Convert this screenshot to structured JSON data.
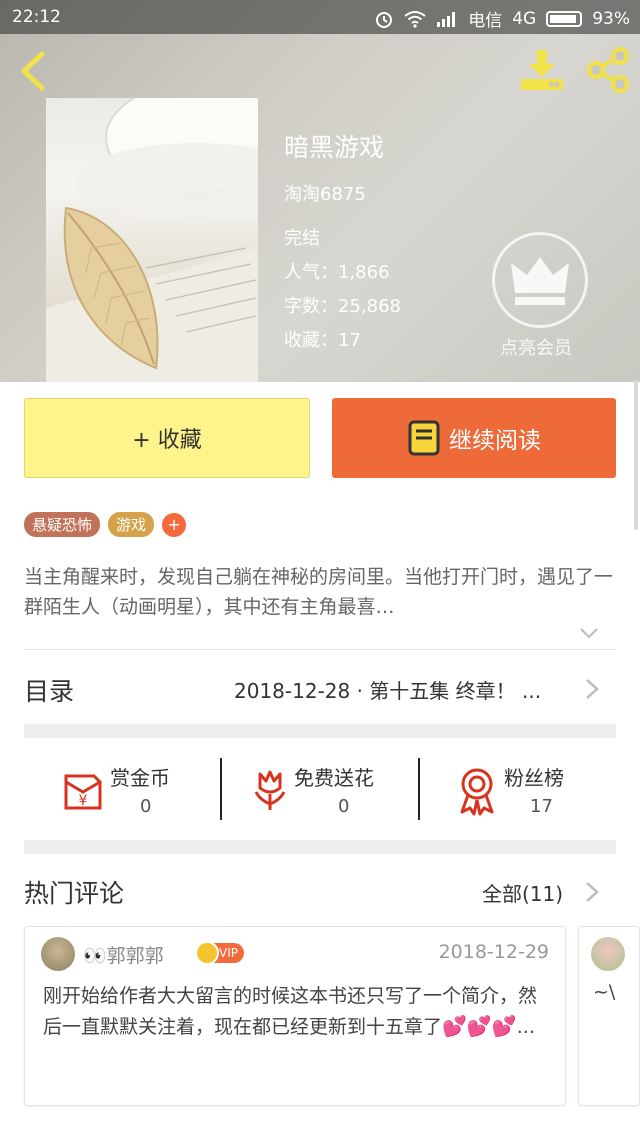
{
  "status": {
    "time": "22:12",
    "carrier": "电信",
    "network": "4G",
    "battery": "93%"
  },
  "book": {
    "title": "暗黑游戏",
    "author": "淘淘6875",
    "status": "完结",
    "popularity": "人气：1,866",
    "words": "字数：25,868",
    "favorites": "收藏：17",
    "vip_label": "点亮会员"
  },
  "actions": {
    "favorite": "+ 收藏",
    "continue": "继续阅读"
  },
  "tags": [
    {
      "label": "悬疑恐怖",
      "color": "#c0735a"
    },
    {
      "label": "游戏",
      "color": "#d4a24a"
    }
  ],
  "tag_add": "+",
  "intro": "当主角醒来时，发现自己躺在神秘的房间里。当他打开门时，遇见了一群陌生人（动画明星），其中还有主角最喜…",
  "toc": {
    "label": "目录",
    "latest": "2018-12-28 · 第十五集 终章！ ..."
  },
  "stats": [
    {
      "label": "赏金币",
      "count": "0",
      "icon": "red-envelope-icon"
    },
    {
      "label": "免费送花",
      "count": "0",
      "icon": "flower-icon"
    },
    {
      "label": "粉丝榜",
      "count": "17",
      "icon": "ribbon-medal-icon"
    }
  ],
  "comments": {
    "title": "热门评论",
    "all": "全部(11)",
    "items": [
      {
        "user": "👀郭郭郭",
        "vip": "VIP",
        "date": "2018-12-29",
        "text": "刚开始给作者大大留言的时候这本书还只写了一个简介，然后一直默默关注着，现在都已经更新到十五章了",
        "hearts": "💕💕💕",
        "ellipsis": "..."
      },
      {
        "text": "~\\"
      }
    ]
  },
  "colors": {
    "accent_orange": "#ee6a38",
    "favorite_yellow": "#fff48c",
    "icon_yellow": "#f2e24a",
    "icon_red": "#d8331f"
  }
}
